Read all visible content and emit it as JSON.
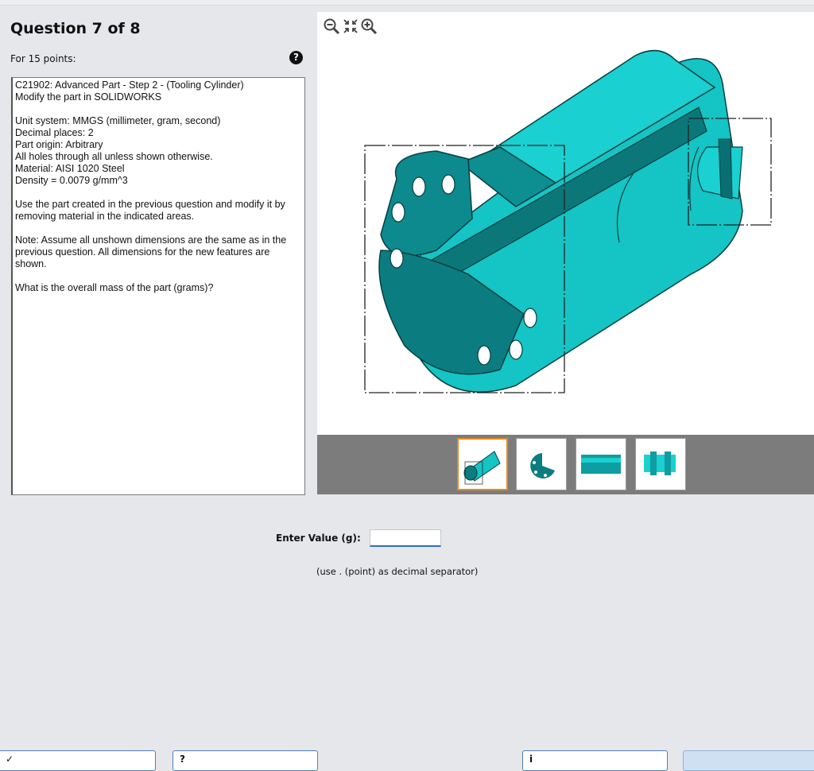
{
  "question": {
    "title": "Question 7 of 8",
    "points": "For 15 points:",
    "paragraphs": [
      "C21902:  Advanced Part - Step 2 - (Tooling Cylinder)\nModify the part in SOLIDWORKS",
      "Unit system: MMGS (millimeter, gram, second)\nDecimal places: 2\nPart origin: Arbitrary\nAll holes through all unless shown otherwise.\nMaterial: AISI 1020 Steel\nDensity = 0.0079 g/mm^3",
      "Use the part created in the previous question and modify it by removing material in the indicated areas.",
      "Note: Assume all unshown dimensions are the same as in the previous question.  All dimensions for the new features are shown.",
      "What is the overall mass of the part (grams)?"
    ]
  },
  "answer": {
    "label": "Enter Value (g):",
    "value": "",
    "hint": "(use . (point) as decimal separator)"
  },
  "icons": {
    "help": "help-icon",
    "zoom_out": "zoom-out-icon",
    "fit": "fit-to-view-icon",
    "zoom_in": "zoom-in-icon"
  },
  "colors": {
    "part": "#15c4c4",
    "part_dark": "#0a6f72",
    "selected_thumb": "#e68a1f",
    "accent": "#2f6fc9"
  },
  "thumbnails": {
    "selected_index": 0,
    "count": 4
  },
  "buttons": [
    "",
    "",
    "",
    ""
  ]
}
